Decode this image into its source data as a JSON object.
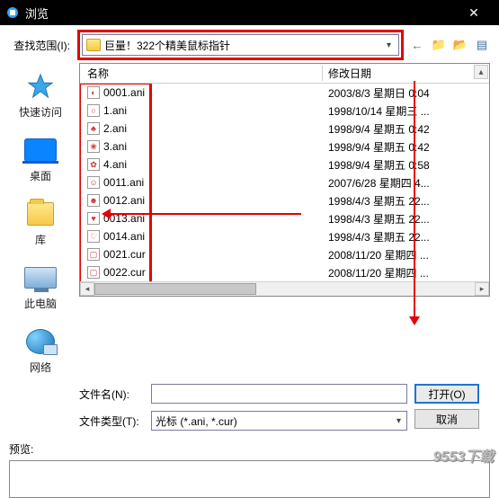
{
  "titlebar": {
    "title": "浏览",
    "close": "✕"
  },
  "lookin": {
    "label": "查找范围(I):",
    "folder": "巨量！322个精美鼠标指针",
    "toolbar": {
      "back": "←",
      "up": "↑",
      "newfolder": "✳",
      "views": "▤"
    }
  },
  "columns": {
    "name": "名称",
    "date": "修改日期"
  },
  "files": [
    {
      "icon": "◐",
      "name": "0001.ani",
      "date": "2003/8/3 星期日 0:04"
    },
    {
      "icon": "○",
      "name": "1.ani",
      "date": "1998/10/14 星期三 ..."
    },
    {
      "icon": "♣",
      "name": "2.ani",
      "date": "1998/9/4 星期五 0:42"
    },
    {
      "icon": "❀",
      "name": "3.ani",
      "date": "1998/9/4 星期五 0:42"
    },
    {
      "icon": "✿",
      "name": "4.ani",
      "date": "1998/9/4 星期五 0:58"
    },
    {
      "icon": "☺",
      "name": "0011.ani",
      "date": "2007/6/28 星期四 4..."
    },
    {
      "icon": "☻",
      "name": "0012.ani",
      "date": "1998/4/3 星期五 22..."
    },
    {
      "icon": "♥",
      "name": "0013.ani",
      "date": "1998/4/3 星期五 22..."
    },
    {
      "icon": "♡",
      "name": "0014.ani",
      "date": "1998/4/3 星期五 22..."
    },
    {
      "icon": "▢",
      "name": "0021.cur",
      "date": "2008/11/20 星期四 ..."
    },
    {
      "icon": "▢",
      "name": "0022.cur",
      "date": "2008/11/20 星期四 ..."
    }
  ],
  "places": {
    "quick": "快速访问",
    "desktop": "桌面",
    "library": "库",
    "thispc": "此电脑",
    "network": "网络"
  },
  "form": {
    "filename_label": "文件名(N):",
    "filename_value": "",
    "filetype_label": "文件类型(T):",
    "filetype_value": "光标 (*.ani, *.cur)",
    "open": "打开(O)",
    "cancel": "取消"
  },
  "preview_label": "预览:",
  "watermark": "9553下载"
}
